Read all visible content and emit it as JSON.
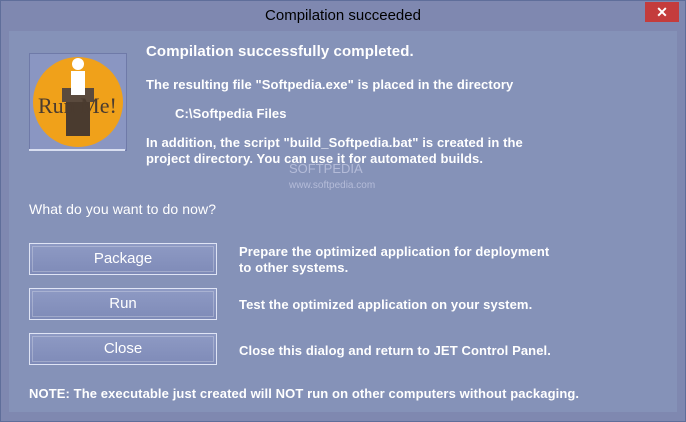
{
  "window": {
    "title": "Compilation succeeded",
    "close_label": "✕"
  },
  "main": {
    "headline": "Compilation successfully completed.",
    "line1": "The resulting file \"Softpedia.exe\" is placed in the directory",
    "directory": "C:\\Softpedia Files",
    "line2a": "In addition, the script \"build_Softpedia.bat\" is created in the",
    "line2b": "project directory. You can use it for automated builds.",
    "question": "What do you want to do now?",
    "note": "NOTE: The executable just created will NOT run on other computers without packaging."
  },
  "actions": [
    {
      "label": "Package",
      "desc1": "Prepare the optimized application for deployment",
      "desc2": "to other systems."
    },
    {
      "label": "Run",
      "desc1": "Test the optimized application on your system.",
      "desc2": ""
    },
    {
      "label": "Close",
      "desc1": "Close this dialog and return to JET Control Panel.",
      "desc2": ""
    }
  ],
  "logo": {
    "text": "Run Me!",
    "icon_name": "coffee-grinder-icon",
    "colors": {
      "orange": "#f0a11a",
      "dark": "#4a3b2f",
      "white": "#ffffff"
    }
  },
  "watermark": {
    "text": "SOFTPEDIA",
    "sub": "www.softpedia.com"
  }
}
